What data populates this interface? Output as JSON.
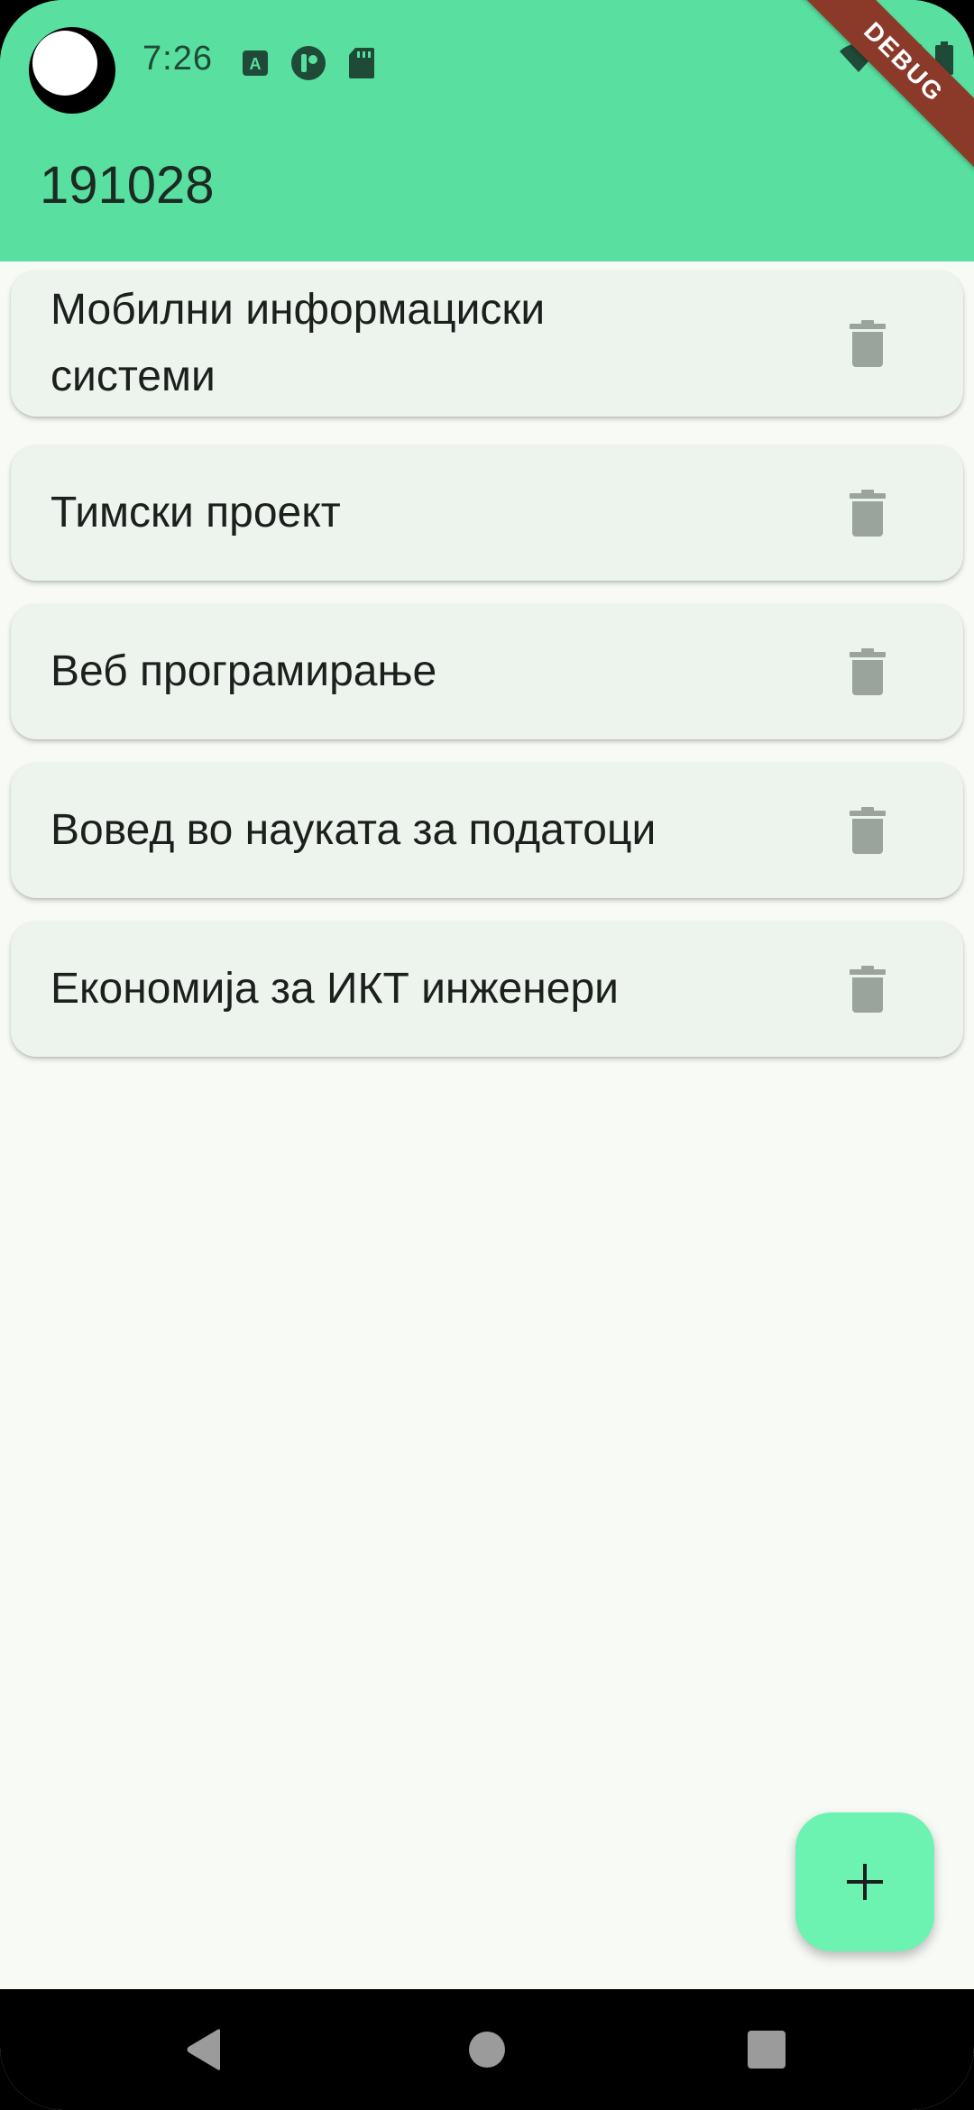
{
  "status_bar": {
    "time": "7:26",
    "icons": [
      "accessibility-a-icon",
      "circle-app-icon",
      "sd-card-icon",
      "wifi-icon",
      "signal-icon",
      "battery-icon"
    ]
  },
  "app_bar": {
    "title": "191028",
    "color": "#59df9f",
    "debug_label": "DEBUG"
  },
  "subjects": [
    {
      "title": "Мобилни информациски системи",
      "action_icon": "trash-icon"
    },
    {
      "title": "Тимски проект",
      "action_icon": "trash-icon"
    },
    {
      "title": "Веб програмирање",
      "action_icon": "trash-icon"
    },
    {
      "title": "Вовед во науката за податоци",
      "action_icon": "trash-icon"
    },
    {
      "title": "Економија за ИКТ инженери",
      "action_icon": "trash-icon"
    }
  ],
  "fab": {
    "icon": "plus-icon",
    "color": "#6cf2b1"
  },
  "nav_bar": {
    "buttons": [
      "back-icon",
      "home-icon",
      "recents-icon"
    ]
  },
  "colors": {
    "background": "#f8faf6",
    "card": "#edf3ed",
    "icon_gray": "#9aa49c"
  }
}
